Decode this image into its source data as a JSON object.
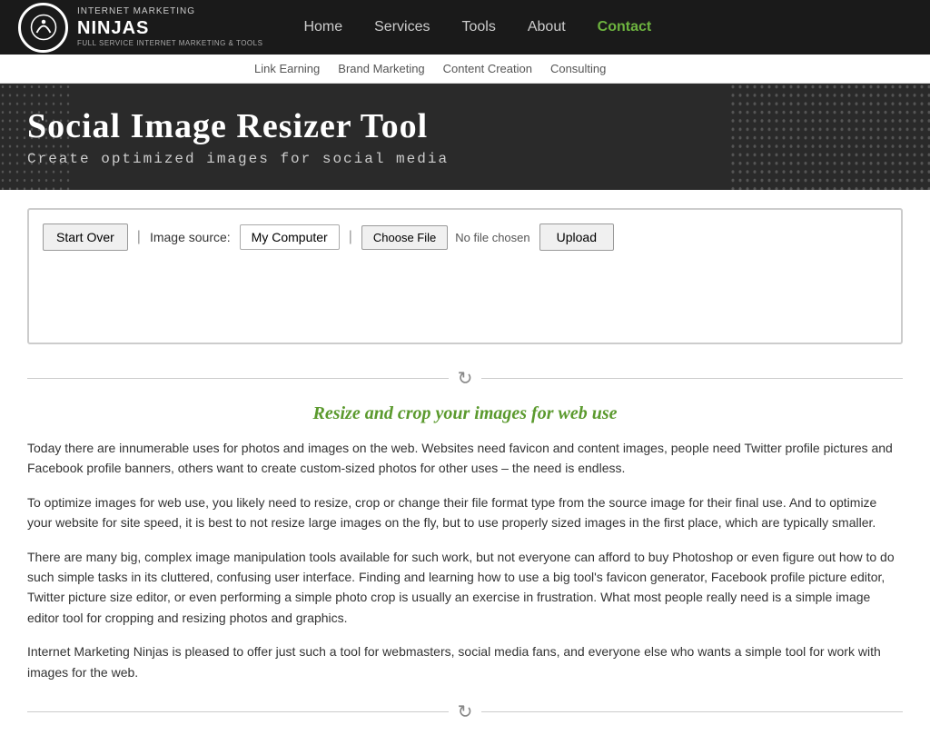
{
  "logo": {
    "top_line": "INTERNET MARKETING",
    "main_line": "NINJAS",
    "sub_line": "FULL SERVICE INTERNET MARKETING & TOOLS"
  },
  "nav": {
    "items": [
      {
        "label": "Home",
        "id": "home",
        "active": false
      },
      {
        "label": "Services",
        "id": "services",
        "active": false
      },
      {
        "label": "Tools",
        "id": "tools",
        "active": false
      },
      {
        "label": "About",
        "id": "about",
        "active": false
      },
      {
        "label": "Contact",
        "id": "contact",
        "active": true
      }
    ],
    "sub_items": [
      {
        "label": "Link Earning",
        "id": "link-earning"
      },
      {
        "label": "Brand Marketing",
        "id": "brand-marketing"
      },
      {
        "label": "Content Creation",
        "id": "content-creation"
      },
      {
        "label": "Consulting",
        "id": "consulting"
      }
    ]
  },
  "hero": {
    "title": "Social Image Resizer Tool",
    "subtitle": "Create optimized images for social media"
  },
  "tool": {
    "start_over_label": "Start Over",
    "image_source_label": "Image source:",
    "my_computer_label": "My Computer",
    "choose_file_label": "Choose File",
    "no_file_label": "No file chosen",
    "upload_label": "Upload"
  },
  "section": {
    "icon": "↻",
    "title": "Resize and crop your images for web use",
    "paragraphs": [
      "Today there are innumerable uses for photos and images on the web. Websites need favicon and content images, people need Twitter profile pictures and Facebook profile banners, others want to create custom-sized photos for other uses – the need is endless.",
      "To optimize images for web use, you likely need to resize, crop or change their file format type from the source image for their final use. And to optimize your website for site speed, it is best to not resize large images on the fly, but to use properly sized images in the first place, which are typically smaller.",
      "There are many big, complex image manipulation tools available for such work, but not everyone can afford to buy Photoshop or even figure out how to do such simple tasks in its cluttered, confusing user interface. Finding and learning how to use a big tool's favicon generator, Facebook profile picture editor, Twitter picture size editor, or even performing a simple photo crop is usually an exercise in frustration. What most people really need is a simple image editor tool for cropping and resizing photos and graphics.",
      "Internet Marketing Ninjas is pleased to offer just such a tool for webmasters, social media fans, and everyone else who wants a simple tool for work with images for the web."
    ]
  }
}
